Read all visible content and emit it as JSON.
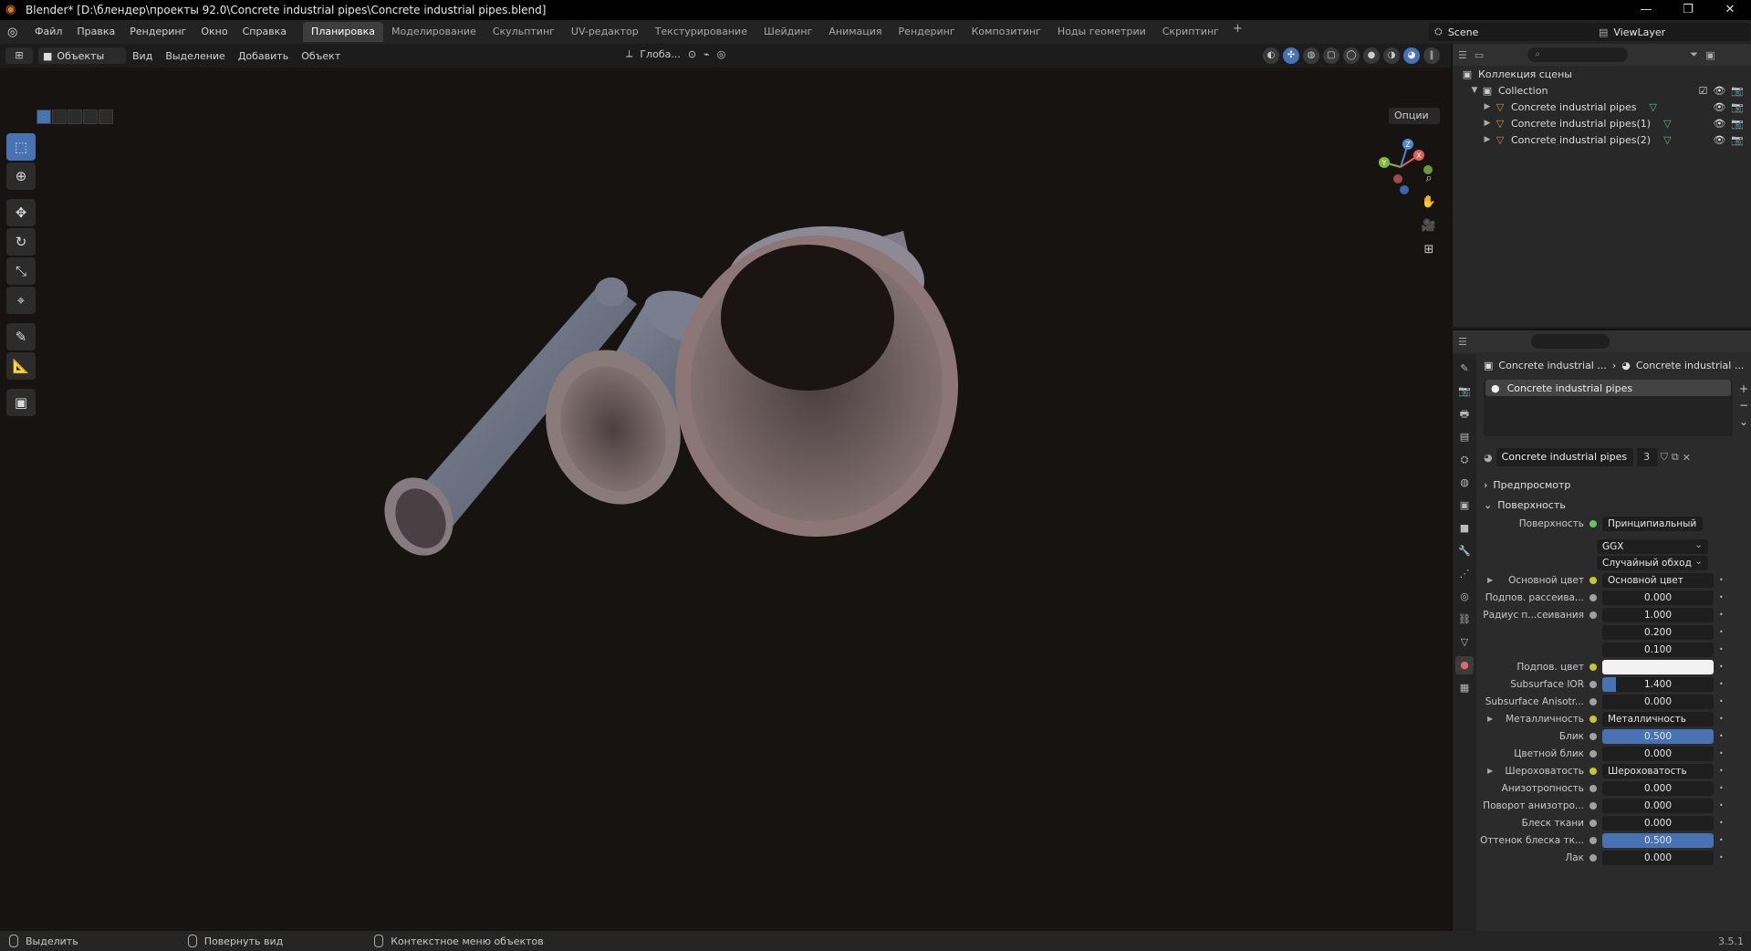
{
  "window": {
    "title": "Blender* [D:\\блендер\\проекты 92.0\\Concrete industrial pipes\\Concrete industrial pipes.blend]",
    "minimize": "—",
    "maximize": "❐",
    "close": "✕"
  },
  "menu": [
    "Файл",
    "Правка",
    "Рендеринг",
    "Окно",
    "Справка"
  ],
  "workspaces": [
    "Планировка",
    "Моделирование",
    "Скульптинг",
    "UV-редактор",
    "Текстурирование",
    "Шейдинг",
    "Анимация",
    "Рендеринг",
    "Композитинг",
    "Ноды геометрии",
    "Скриптинг"
  ],
  "workspace_add": "+",
  "scene": {
    "name": "Scene",
    "view_layer": "ViewLayer"
  },
  "viewport": {
    "mode": "Объекты",
    "menus": [
      "Вид",
      "Выделение",
      "Добавить",
      "Объект"
    ],
    "transform_orientation": "Глоба...",
    "options": "Опции",
    "gizmo": {
      "x": "X",
      "y": "Y",
      "z": "Z"
    }
  },
  "outliner": {
    "root": "Коллекция сцены",
    "collection": "Collection",
    "objects": [
      "Concrete industrial pipes",
      "Concrete industrial pipes(1)",
      "Concrete industrial pipes(2)"
    ]
  },
  "properties": {
    "breadcrumb_object": "Concrete industrial ...",
    "breadcrumb_material": "Concrete industrial ...",
    "slot": "Concrete industrial pipes",
    "material_name": "Concrete industrial pipes",
    "material_users": "3",
    "panel_preview": "Предпросмотр",
    "panel_surface": "Поверхность",
    "surface_label": "Поверхность",
    "surface_value": "Принципиальный BSDF",
    "distribution": "GGX",
    "subsurface_method": "Случайный обход",
    "rows": [
      {
        "label": "Основной цвет",
        "value": "Основной цвет",
        "kind": "link",
        "expand": true
      },
      {
        "label": "Подпов. рассеива...",
        "value": "0.000",
        "kind": "num",
        "fill": 0
      },
      {
        "label": "Радиус п...сеивания",
        "value": "1.000",
        "kind": "num",
        "fill": 0
      },
      {
        "label": "",
        "value": "0.200",
        "kind": "num",
        "fill": 0
      },
      {
        "label": "",
        "value": "0.100",
        "kind": "num",
        "fill": 0
      },
      {
        "label": "Подпов. цвет",
        "value": "",
        "kind": "color"
      },
      {
        "label": "Subsurface IOR",
        "value": "1.400",
        "kind": "num",
        "fill": 0.12
      },
      {
        "label": "Subsurface Anisotr...",
        "value": "0.000",
        "kind": "num",
        "fill": 0
      },
      {
        "label": "Металличность",
        "value": "Металличность",
        "kind": "link",
        "expand": true
      },
      {
        "label": "Блик",
        "value": "0.500",
        "kind": "num",
        "fill": 1.0
      },
      {
        "label": "Цветной блик",
        "value": "0.000",
        "kind": "num",
        "fill": 0
      },
      {
        "label": "Шероховатость",
        "value": "Шероховатость",
        "kind": "link",
        "expand": true
      },
      {
        "label": "Анизотропность",
        "value": "0.000",
        "kind": "num",
        "fill": 0
      },
      {
        "label": "Поворот анизотро...",
        "value": "0.000",
        "kind": "num",
        "fill": 0
      },
      {
        "label": "Блеск ткани",
        "value": "0.000",
        "kind": "num",
        "fill": 0
      },
      {
        "label": "Оттенок блеска тк...",
        "value": "0.500",
        "kind": "num",
        "fill": 1.0
      },
      {
        "label": "Лак",
        "value": "0.000",
        "kind": "num",
        "fill": 0
      }
    ]
  },
  "status": {
    "select": "Выделить",
    "rotate_view": "Повернуть вид",
    "context_menu": "Контекстное меню объектов",
    "version": "3.5.1"
  },
  "colors": {
    "accent": "#4772b3",
    "bg": "#1d1d1d",
    "viewport": "#171311"
  }
}
